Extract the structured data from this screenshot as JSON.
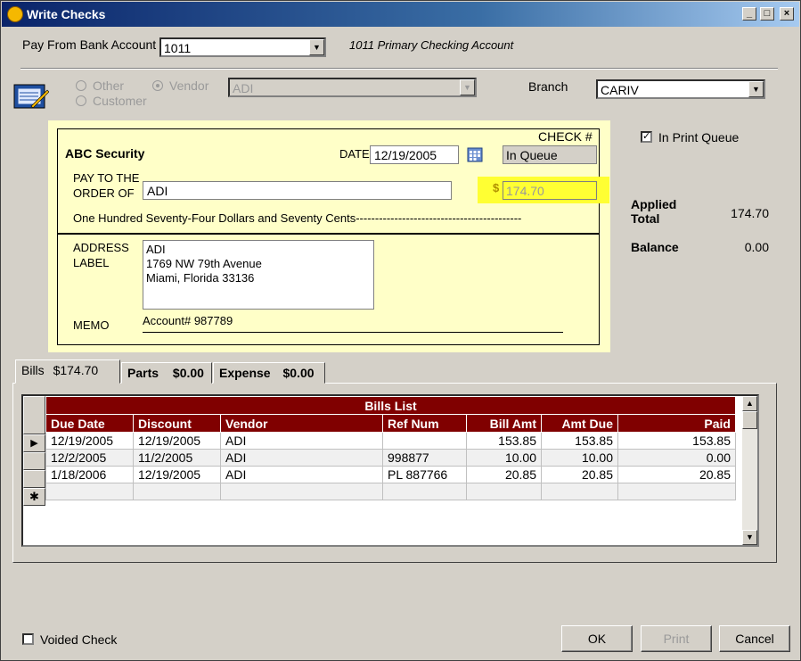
{
  "window": {
    "title": "Write Checks",
    "minimize": "_",
    "maximize": "□",
    "close": "×"
  },
  "bank": {
    "label": "Pay From Bank Account",
    "value": "1011",
    "description": "1011 Primary Checking Account"
  },
  "payee_type": {
    "other": "Other",
    "vendor": "Vendor",
    "customer": "Customer",
    "vendor_value": "ADI"
  },
  "branch": {
    "label": "Branch",
    "value": "CARIV"
  },
  "check": {
    "company": "ABC Security",
    "check_num_label": "CHECK #",
    "date_label": "DATE",
    "date": "12/19/2005",
    "status": "In Queue",
    "pay_to_label_1": "PAY TO THE",
    "pay_to_label_2": "ORDER OF",
    "payee": "ADI",
    "dollar_sign": "$",
    "amount": "174.70",
    "amount_words": "One Hundred Seventy-Four Dollars and Seventy Cents-------------------------------------------",
    "address_label_1": "ADDRESS",
    "address_label_2": "LABEL",
    "address_lines": [
      "ADI",
      "1769 NW 79th Avenue",
      "Miami, Florida  33136"
    ],
    "memo_label": "MEMO",
    "memo": "Account# 987789"
  },
  "print_queue": {
    "label": "In Print Queue",
    "checked": true
  },
  "summary": {
    "applied_label_1": "Applied",
    "applied_label_2": "Total",
    "applied_value": "174.70",
    "balance_label": "Balance",
    "balance_value": "0.00"
  },
  "tabs": [
    {
      "name": "Bills",
      "amount": "$174.70"
    },
    {
      "name": "Parts",
      "amount": "$0.00"
    },
    {
      "name": "Expense",
      "amount": "$0.00"
    }
  ],
  "bills": {
    "title": "Bills List",
    "columns": [
      "Due Date",
      "Discount",
      "Vendor",
      "Ref Num",
      "Bill Amt",
      "Amt Due",
      "Paid"
    ],
    "rows": [
      [
        "12/19/2005",
        "12/19/2005",
        "ADI",
        "",
        "153.85",
        "153.85",
        "153.85"
      ],
      [
        "12/2/2005",
        "11/2/2005",
        "ADI",
        "998877",
        "10.00",
        "10.00",
        "0.00"
      ],
      [
        "1/18/2006",
        "12/19/2005",
        "ADI",
        "PL 887766",
        "20.85",
        "20.85",
        "20.85"
      ]
    ],
    "current_marker": "▶",
    "new_marker": "✱"
  },
  "voided": {
    "label": "Voided Check",
    "checked": false
  },
  "buttons": {
    "ok": "OK",
    "print": "Print",
    "cancel": "Cancel"
  },
  "colors": {
    "highlight": "#ffffc8",
    "header": "#800000",
    "marker": "#ffff33"
  }
}
